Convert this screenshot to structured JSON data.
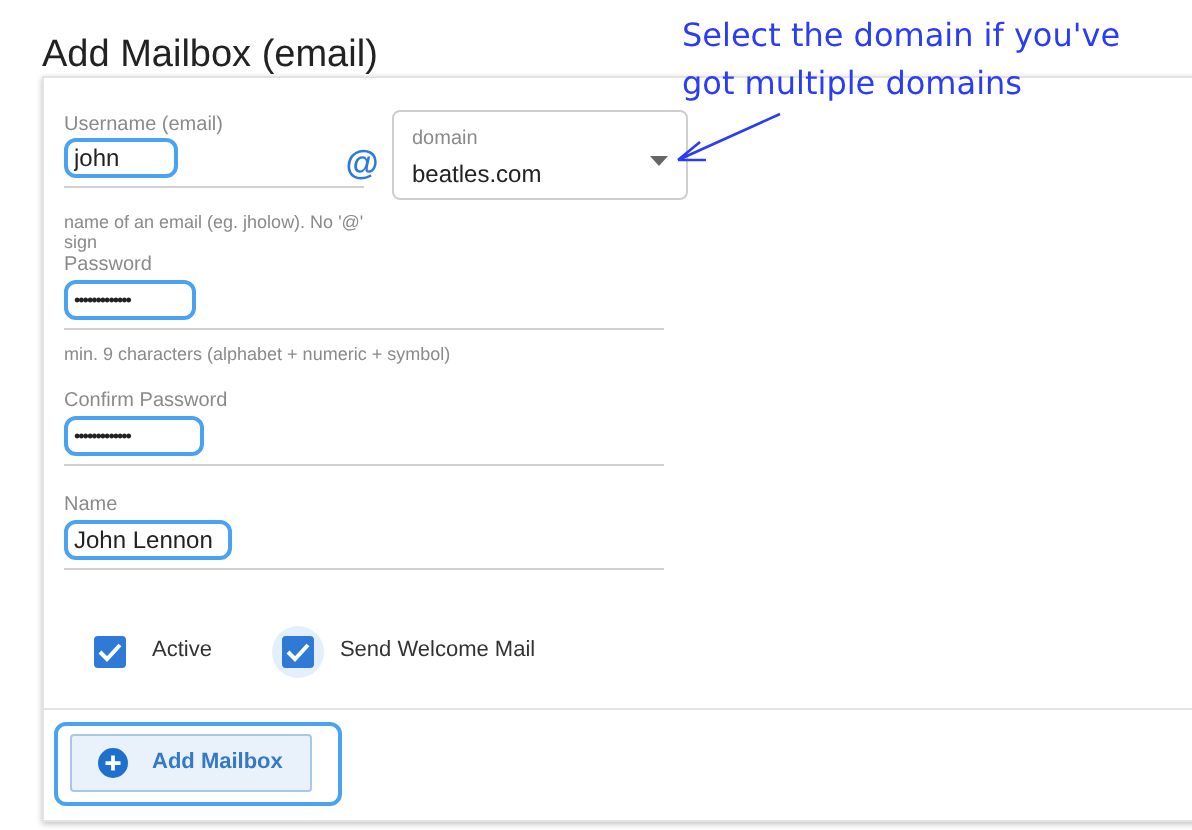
{
  "title": "Add Mailbox (email)",
  "annotation": "Select the domain if you've got multiple domains",
  "username": {
    "label": "Username (email)",
    "value": "john",
    "hint": "name of an email (eg. jholow). No '@' sign"
  },
  "at_sign": "@",
  "domain": {
    "label": "domain",
    "value": "beatles.com"
  },
  "password": {
    "label": "Password",
    "value": "•••••••••••••",
    "hint": "min. 9 characters (alphabet + numeric + symbol)"
  },
  "confirm_password": {
    "label": "Confirm Password",
    "value": "•••••••••••••"
  },
  "name": {
    "label": "Name",
    "value": "John Lennon"
  },
  "checkboxes": [
    {
      "label": "Active",
      "checked": true,
      "focused": false
    },
    {
      "label": "Send Welcome Mail",
      "checked": true,
      "focused": true
    }
  ],
  "button": {
    "label": "Add Mailbox"
  }
}
